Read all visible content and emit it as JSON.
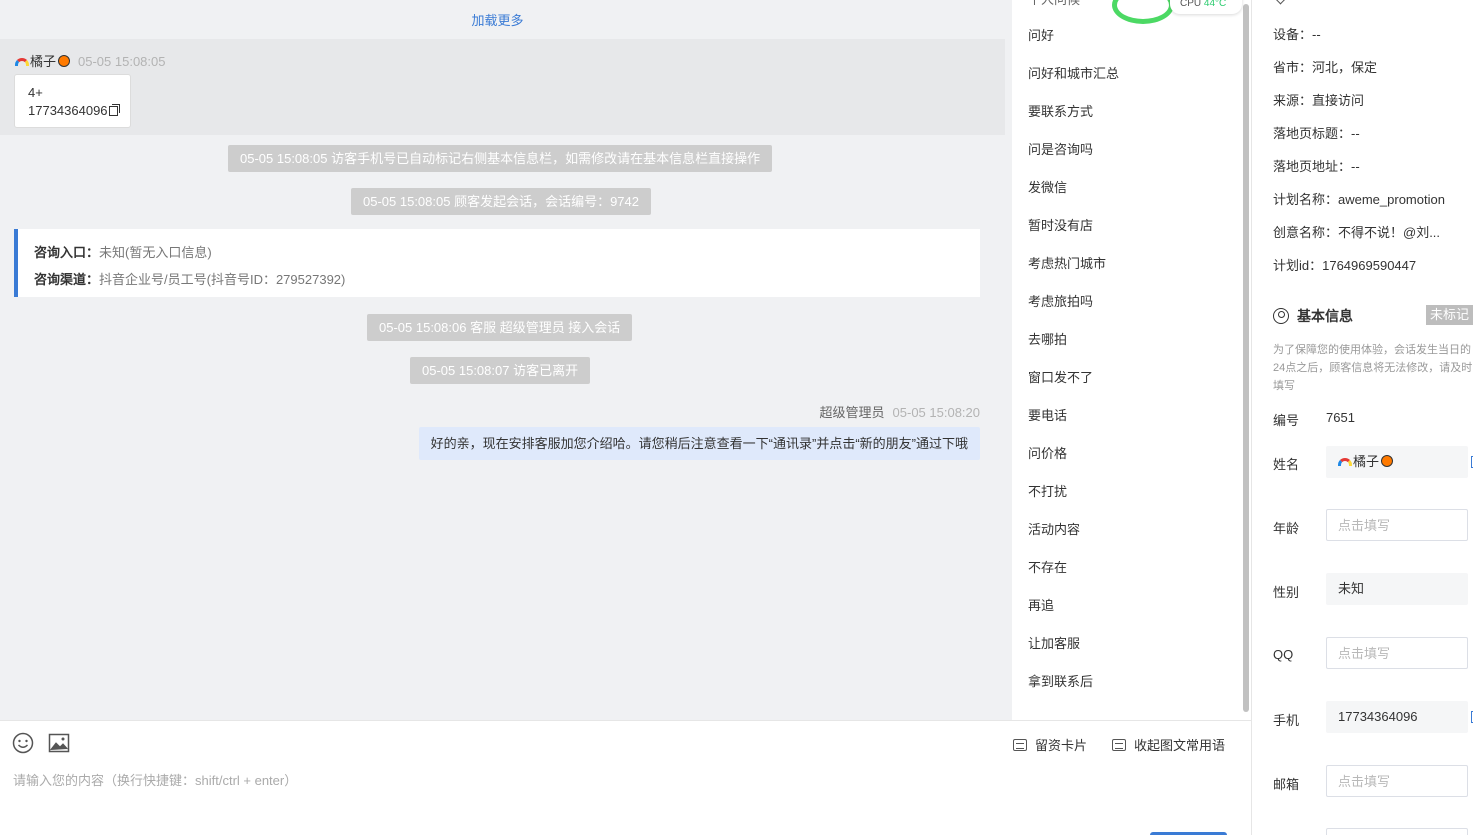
{
  "chat": {
    "load_more": "加载更多",
    "visitor": {
      "name": "橘子",
      "time": "05-05 15:08:05",
      "card_line1": "4+",
      "card_line2": "17734364096"
    },
    "notices": [
      "05-05 15:08:05 访客手机号已自动标记右侧基本信息栏，如需修改请在基本信息栏直接操作",
      "05-05 15:08:05 顾客发起会话，会话编号：9742",
      "05-05 15:08:06 客服 超级管理员 接入会话",
      "05-05 15:08:07 访客已离开"
    ],
    "entry": {
      "label1": "咨询入口：",
      "value1": "未知(暂无入口信息)",
      "label2": "咨询渠道：",
      "value2": "抖音企业号/员工号(抖音号ID：279527392)"
    },
    "agent": {
      "name": "超级管理员",
      "time": "05-05 15:08:20",
      "message": "好的亲，现在安排客服加您介绍哈。请您稍后注意查看一下“通讯录”并点击“新的朋友”通过下哦"
    }
  },
  "quick_replies": [
    "问好",
    "问好和城市汇总",
    "要联系方式",
    "问是咨询吗",
    "发微信",
    "暂时没有店",
    "考虑热门城市",
    "考虑旅拍吗",
    "去哪拍",
    "窗口发不了",
    "要电话",
    "问价格",
    "不打扰",
    "活动内容",
    "不存在",
    "再追",
    "让加客服",
    "拿到联系后"
  ],
  "quick_partial_top": "个人问候",
  "perf": {
    "cpu_label": "CPU",
    "temp": "44°C"
  },
  "input": {
    "placeholder": "请输入您的内容（换行快捷键：shift/ctrl + enter）",
    "card_button": "留资卡片",
    "collapse_button": "收起图文常用语",
    "icons": [
      "emoji-icon",
      "image-icon"
    ]
  },
  "info": {
    "source_rows": [
      "设备：--",
      "省市：河北，保定",
      "来源：直接访问",
      "落地页标题：--",
      "落地页地址：--",
      "计划名称：aweme_promotion",
      "创意名称：不得不说！@刘...",
      "计划id：1764969590447"
    ],
    "basic_title": "基本信息",
    "unmarked_tag": "未标记",
    "note": "为了保障您的使用体验，会话发生当日的24点之后，顾客信息将无法修改，请及时填写",
    "fields": {
      "id_label": "编号",
      "id_value": "7651",
      "name_label": "姓名",
      "name_value": "橘子",
      "age_label": "年龄",
      "age_placeholder": "点击填写",
      "gender_label": "性别",
      "gender_value": "未知",
      "qq_label": "QQ",
      "qq_placeholder": "点击填写",
      "phone_label": "手机",
      "phone_value": "17734364096",
      "email_label": "邮箱",
      "email_placeholder": "点击填写"
    }
  },
  "colors": {
    "accent": "#3a7bd5",
    "notice_bg": "#cdcdcd",
    "agent_bubble": "#dfe9fb",
    "perf_ring": "#4cd964"
  }
}
